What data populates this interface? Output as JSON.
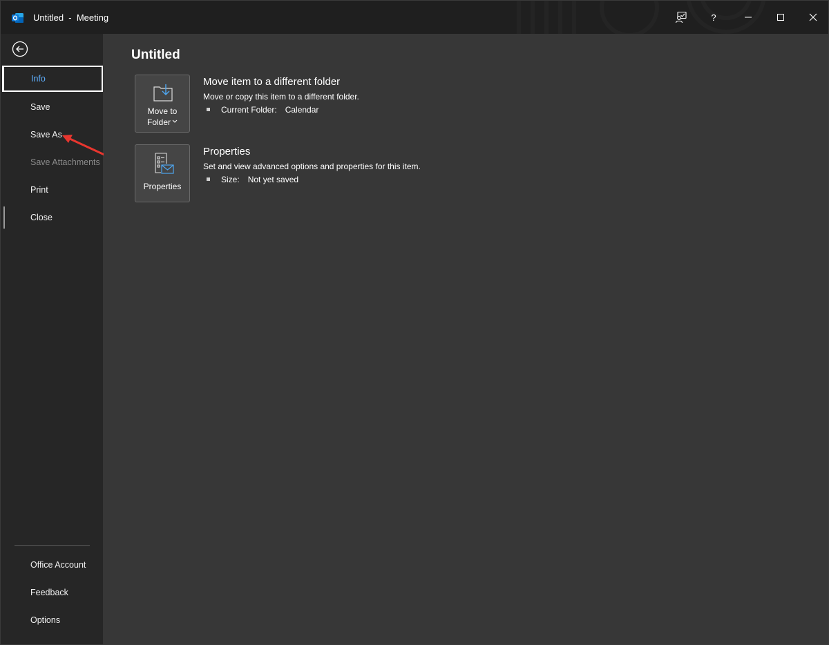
{
  "window": {
    "title": "Untitled  -  Meeting",
    "app_icon": "outlook-icon",
    "buttons": [
      "coauthor-icon",
      "help-icon",
      "minimize-icon",
      "maximize-icon",
      "close-icon"
    ],
    "help_label": "?"
  },
  "sidebar": {
    "back_icon": "back-arrow-icon",
    "items": [
      {
        "label": "Info",
        "state": "selected"
      },
      {
        "label": "Save",
        "state": "normal"
      },
      {
        "label": "Save As",
        "state": "normal"
      },
      {
        "label": "Save Attachments",
        "state": "disabled"
      },
      {
        "label": "Print",
        "state": "normal"
      },
      {
        "label": "Close",
        "state": "normal"
      }
    ],
    "footer_items": [
      {
        "label": "Office Account"
      },
      {
        "label": "Feedback"
      },
      {
        "label": "Options"
      }
    ]
  },
  "main": {
    "title": "Untitled",
    "sections": [
      {
        "tile_label_line1": "Move to",
        "tile_label_line2": "Folder",
        "tile_icon": "move-to-folder-icon",
        "title": "Move item to a different folder",
        "description": "Move or copy this item to a different folder.",
        "row_label": "Current Folder:",
        "row_value": "Calendar"
      },
      {
        "tile_label_line1": "Properties",
        "tile_icon": "properties-icon",
        "title": "Properties",
        "description": "Set and view advanced options and properties for this item.",
        "row_label": "Size:",
        "row_value": "Not yet saved"
      }
    ]
  },
  "colors": {
    "accent": "#5fb0ff",
    "annotation_arrow": "#e8362f",
    "background": "#373737",
    "sidebar": "#262626",
    "titlebar": "#1f1f1f"
  }
}
